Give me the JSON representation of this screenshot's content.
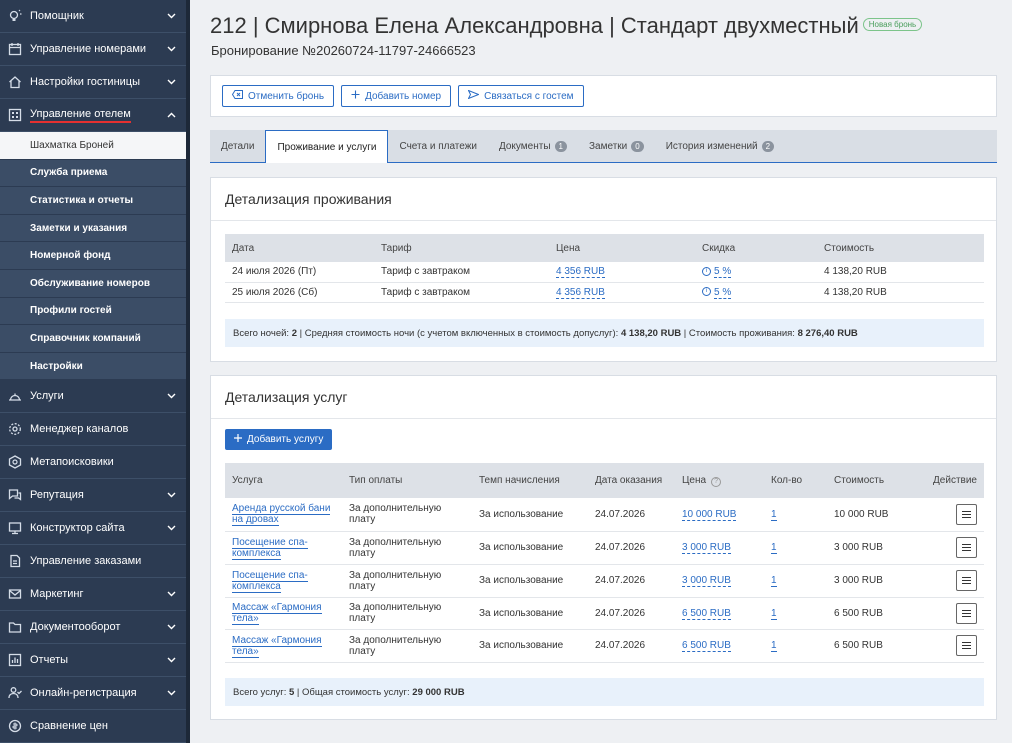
{
  "sidebar": {
    "top_items": [
      {
        "label": "Помощник",
        "icon": "lightbulb-icon"
      },
      {
        "label": "Управление номерами",
        "icon": "calendar-icon"
      },
      {
        "label": "Настройки гостиницы",
        "icon": "house-icon"
      },
      {
        "label": "Управление отелем",
        "icon": "hotel-icon"
      }
    ],
    "sub_items": [
      "Шахматка Броней",
      "Служба приема",
      "Статистика и отчеты",
      "Заметки и указания",
      "Номерной фонд",
      "Обслуживание номеров",
      "Профили гостей",
      "Справочник компаний",
      "Настройки"
    ],
    "bottom_items": [
      {
        "label": "Услуги",
        "icon": "services-icon"
      },
      {
        "label": "Менеджер каналов",
        "icon": "channels-icon"
      },
      {
        "label": "Метапоисковики",
        "icon": "meta-search-icon"
      },
      {
        "label": "Репутация",
        "icon": "reputation-icon"
      },
      {
        "label": "Конструктор сайта",
        "icon": "monitor-icon"
      },
      {
        "label": "Управление заказами",
        "icon": "orders-icon"
      },
      {
        "label": "Маркетинг",
        "icon": "mail-icon"
      },
      {
        "label": "Документооборот",
        "icon": "folder-icon"
      },
      {
        "label": "Отчеты",
        "icon": "chart-icon"
      },
      {
        "label": "Онлайн-регистрация",
        "icon": "user-check-icon"
      },
      {
        "label": "Сравнение цен",
        "icon": "price-compare-icon"
      }
    ]
  },
  "header": {
    "title": "212 | Смирнова Елена Александровна | Стандарт двухместный",
    "badge": "Новая бронь",
    "subtitle": "Бронирование №20260724-11797-24666523"
  },
  "actions": {
    "cancel": "Отменить бронь",
    "add_room": "Добавить номер",
    "contact": "Связаться с гостем"
  },
  "tabs": [
    {
      "label": "Детали",
      "count": ""
    },
    {
      "label": "Проживание и услуги",
      "count": ""
    },
    {
      "label": "Счета и платежи",
      "count": ""
    },
    {
      "label": "Документы",
      "count": "1"
    },
    {
      "label": "Заметки",
      "count": "0"
    },
    {
      "label": "История изменений",
      "count": "2"
    }
  ],
  "stay": {
    "title": "Детализация проживания",
    "headers": [
      "Дата",
      "Тариф",
      "Цена",
      "Скидка",
      "Стоимость"
    ],
    "rows": [
      {
        "date": "24 июля 2026 (Пт)",
        "tariff": "Тариф с завтраком",
        "price": "4 356 RUB",
        "discount": "5 %",
        "cost": "4 138,20 RUB"
      },
      {
        "date": "25 июля 2026 (Сб)",
        "tariff": "Тариф с завтраком",
        "price": "4 356 RUB",
        "discount": "5 %",
        "cost": "4 138,20 RUB"
      }
    ],
    "summary": {
      "nights_label": "Всего ночей:",
      "nights": "2",
      "avg_label": "Средняя стоимость ночи (с учетом включенных в стоимость допуслуг):",
      "avg": "4 138,20 RUB",
      "total_label": "Стоимость проживания:",
      "total": "8 276,40 RUB"
    }
  },
  "services": {
    "title": "Детализация услуг",
    "add_button": "Добавить услугу",
    "headers": [
      "Услуга",
      "Тип оплаты",
      "Темп начисления",
      "Дата оказания",
      "Цена",
      "Кол-во",
      "Стоимость",
      "Действие"
    ],
    "rows": [
      {
        "name": "Аренда русской бани на дровах",
        "payment": "За дополнительную плату",
        "rate": "За использование",
        "date": "24.07.2026",
        "price": "10 000 RUB",
        "qty": "1",
        "cost": "10 000 RUB"
      },
      {
        "name": "Посещение спа-комплекса",
        "payment": "За дополнительную плату",
        "rate": "За использование",
        "date": "24.07.2026",
        "price": "3 000 RUB",
        "qty": "1",
        "cost": "3 000 RUB"
      },
      {
        "name": "Посещение спа-комплекса",
        "payment": "За дополнительную плату",
        "rate": "За использование",
        "date": "24.07.2026",
        "price": "3 000 RUB",
        "qty": "1",
        "cost": "3 000 RUB"
      },
      {
        "name": "Массаж «Гармония тела»",
        "payment": "За дополнительную плату",
        "rate": "За использование",
        "date": "24.07.2026",
        "price": "6 500 RUB",
        "qty": "1",
        "cost": "6 500 RUB"
      },
      {
        "name": "Массаж «Гармония тела»",
        "payment": "За дополнительную плату",
        "rate": "За использование",
        "date": "24.07.2026",
        "price": "6 500 RUB",
        "qty": "1",
        "cost": "6 500 RUB"
      }
    ],
    "summary": {
      "count_label": "Всего услуг:",
      "count": "5",
      "total_label": "Общая стоимость услуг:",
      "total": "29 000 RUB"
    }
  }
}
